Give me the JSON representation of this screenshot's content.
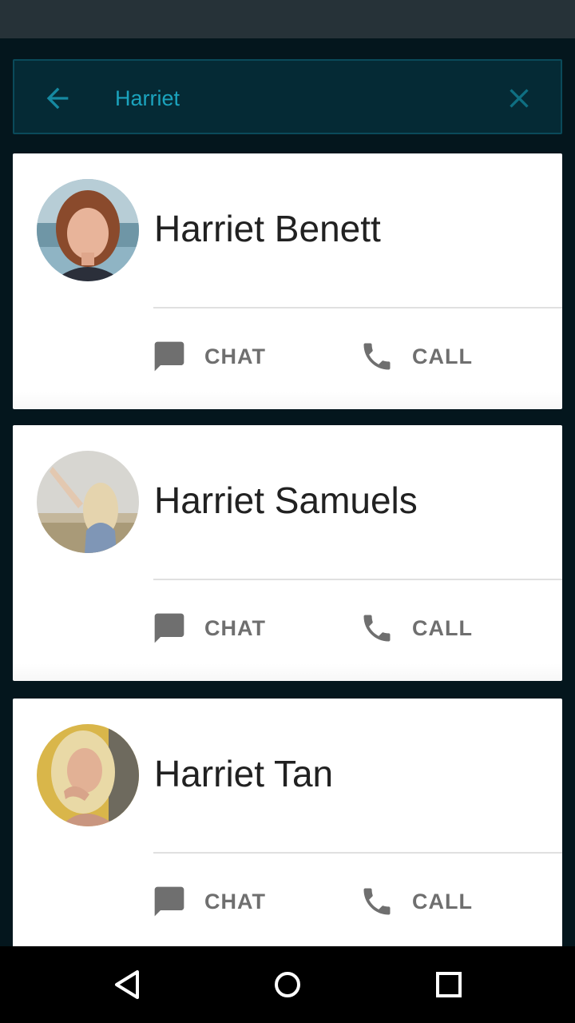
{
  "search": {
    "query": "Harriet",
    "back_icon": "arrow-left-icon",
    "clear_icon": "close-icon"
  },
  "contacts": [
    {
      "name": "Harriet Benett",
      "chat_label": "CHAT",
      "call_label": "CALL"
    },
    {
      "name": "Harriet Samuels",
      "chat_label": "CHAT",
      "call_label": "CALL"
    },
    {
      "name": "Harriet Tan",
      "chat_label": "CHAT",
      "call_label": "CALL"
    }
  ],
  "navigation": {
    "back_icon": "triangle-back-icon",
    "home_icon": "circle-home-icon",
    "recents_icon": "square-recents-icon"
  },
  "colors": {
    "status_bar": "#263238",
    "background": "#04161d",
    "search_bar": "#052a35",
    "accent": "#1ba3bd",
    "card": "#ffffff",
    "action_gray": "#6f6f6f",
    "nav_bar": "#000000"
  }
}
